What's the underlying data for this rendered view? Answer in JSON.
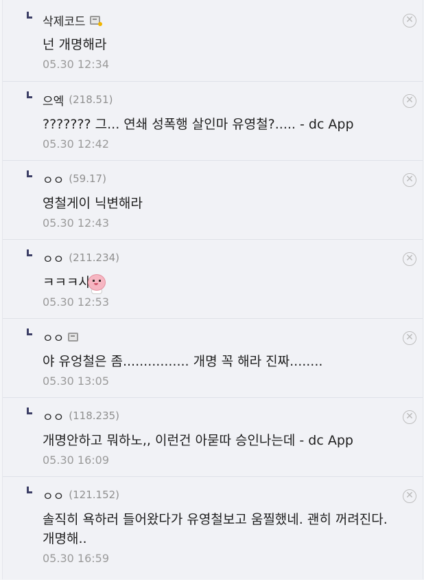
{
  "replies": [
    {
      "nick": "삭제코드",
      "ip": "",
      "badge": "gold",
      "text": "넌 개명해라",
      "date": "05.30 12:34"
    },
    {
      "nick": "으엑",
      "ip": "(218.51)",
      "badge": "",
      "text": "??????? 그... 연쇄 성폭행 살인마 유영철?..... - dc App",
      "date": "05.30 12:42"
    },
    {
      "nick": "ㅇㅇ",
      "ip": "(59.17)",
      "badge": "",
      "text": "영철게이 닉변해라",
      "date": "05.30 12:43"
    },
    {
      "nick": "ㅇㅇ",
      "ip": "(211.234)",
      "badge": "",
      "text": "ㅋㅋㅋ사",
      "date": "05.30 12:53",
      "emoticon": "peach-emoticon"
    },
    {
      "nick": "ㅇㅇ",
      "ip": "",
      "badge": "gray",
      "text": "야 유엉철은 좀................ 개명 꼭 해라 진짜........",
      "date": "05.30 13:05"
    },
    {
      "nick": "ㅇㅇ",
      "ip": "(118.235)",
      "badge": "",
      "text": "개명안하고 뭐하노,, 이런건 아묻따 승인나는데 - dc App",
      "date": "05.30 16:09"
    },
    {
      "nick": "ㅇㅇ",
      "ip": "(121.152)",
      "badge": "",
      "text": "솔직히 욕하러 들어왔다가 유영철보고 움찔했네. 괜히 꺼려진다.\n개명해..",
      "date": "05.30 16:59"
    }
  ],
  "delete_glyph": "✕"
}
